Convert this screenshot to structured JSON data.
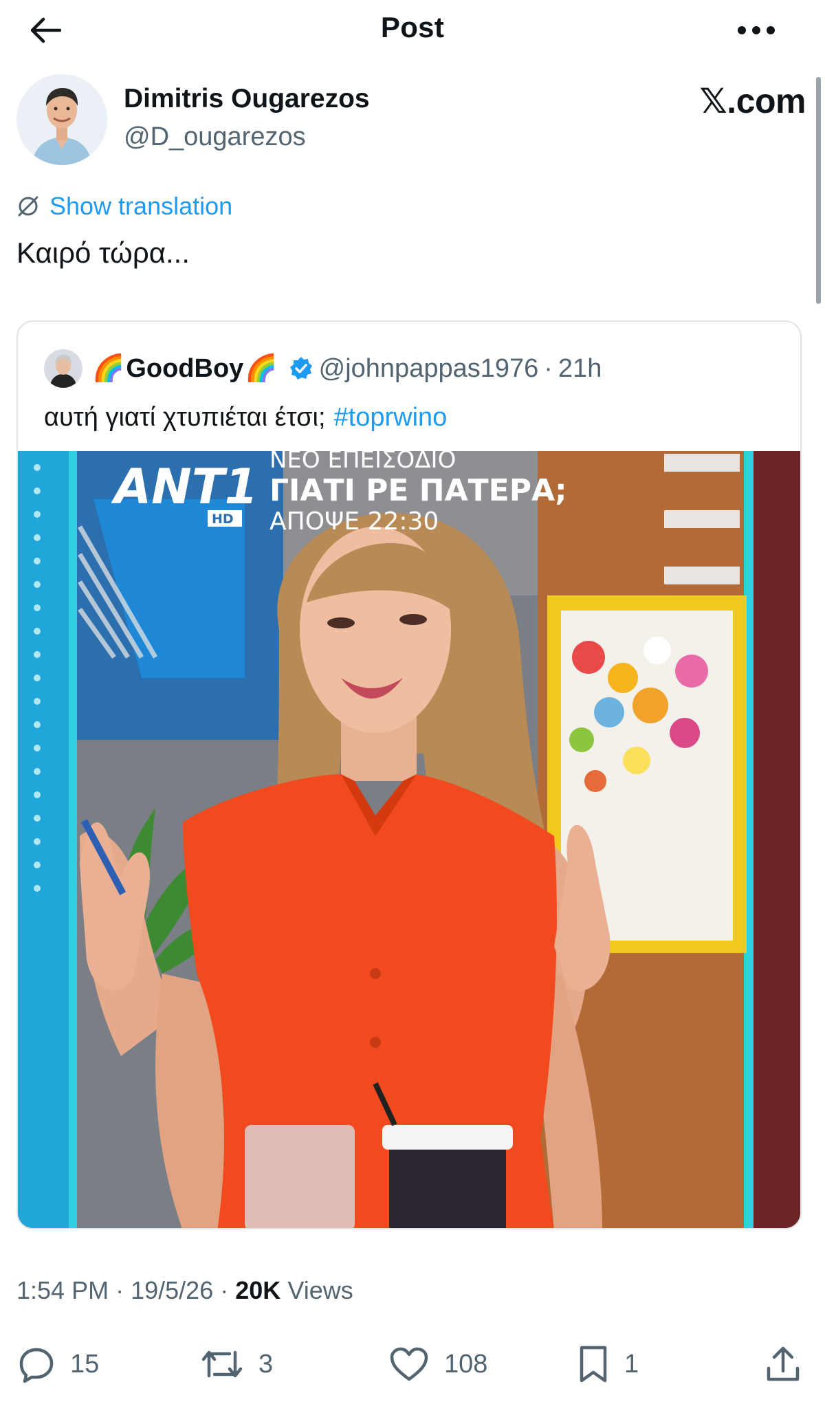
{
  "header": {
    "title": "Post",
    "back_icon": "arrow-left-icon",
    "more_icon": "more-horizontal-icon"
  },
  "post": {
    "author_name": "Dimitris Ougarezos",
    "author_handle": "@D_ougarezos",
    "site_mark": "𝕏.com",
    "translation_label": "Show translation",
    "text": "Καιρό τώρα...",
    "timestamp": "1:54 PM",
    "date": "19/5/26",
    "views_count": "20K",
    "views_label": "Views"
  },
  "quoted": {
    "name_emoji": "🌈",
    "author_name": "GoodBoy",
    "verified": true,
    "handle": "@johnpappas1976",
    "separator": "·",
    "time": "21h",
    "text": "αυτή γιατί χτυπιέται έτσι;",
    "hashtag": "#toprwino",
    "media": {
      "channel_logo": "ANT1",
      "channel_sub": "HD",
      "overlay_line1": "ΝΕΟ ΕΠΕΙΣΟΔΙΟ",
      "overlay_line2": "ΓΙΑΤΙ ΡΕ ΠΑΤΕΡΑ;",
      "overlay_line3": "ΑΠΟΨΕ 22:30"
    }
  },
  "meta": {
    "separator": "·"
  },
  "actions": {
    "replies": "15",
    "reposts": "3",
    "likes": "108",
    "bookmarks": "1"
  },
  "colors": {
    "accent": "#1d9bf0",
    "muted_text": "#536471",
    "text": "#0f1419",
    "border": "#dfe4e8"
  }
}
